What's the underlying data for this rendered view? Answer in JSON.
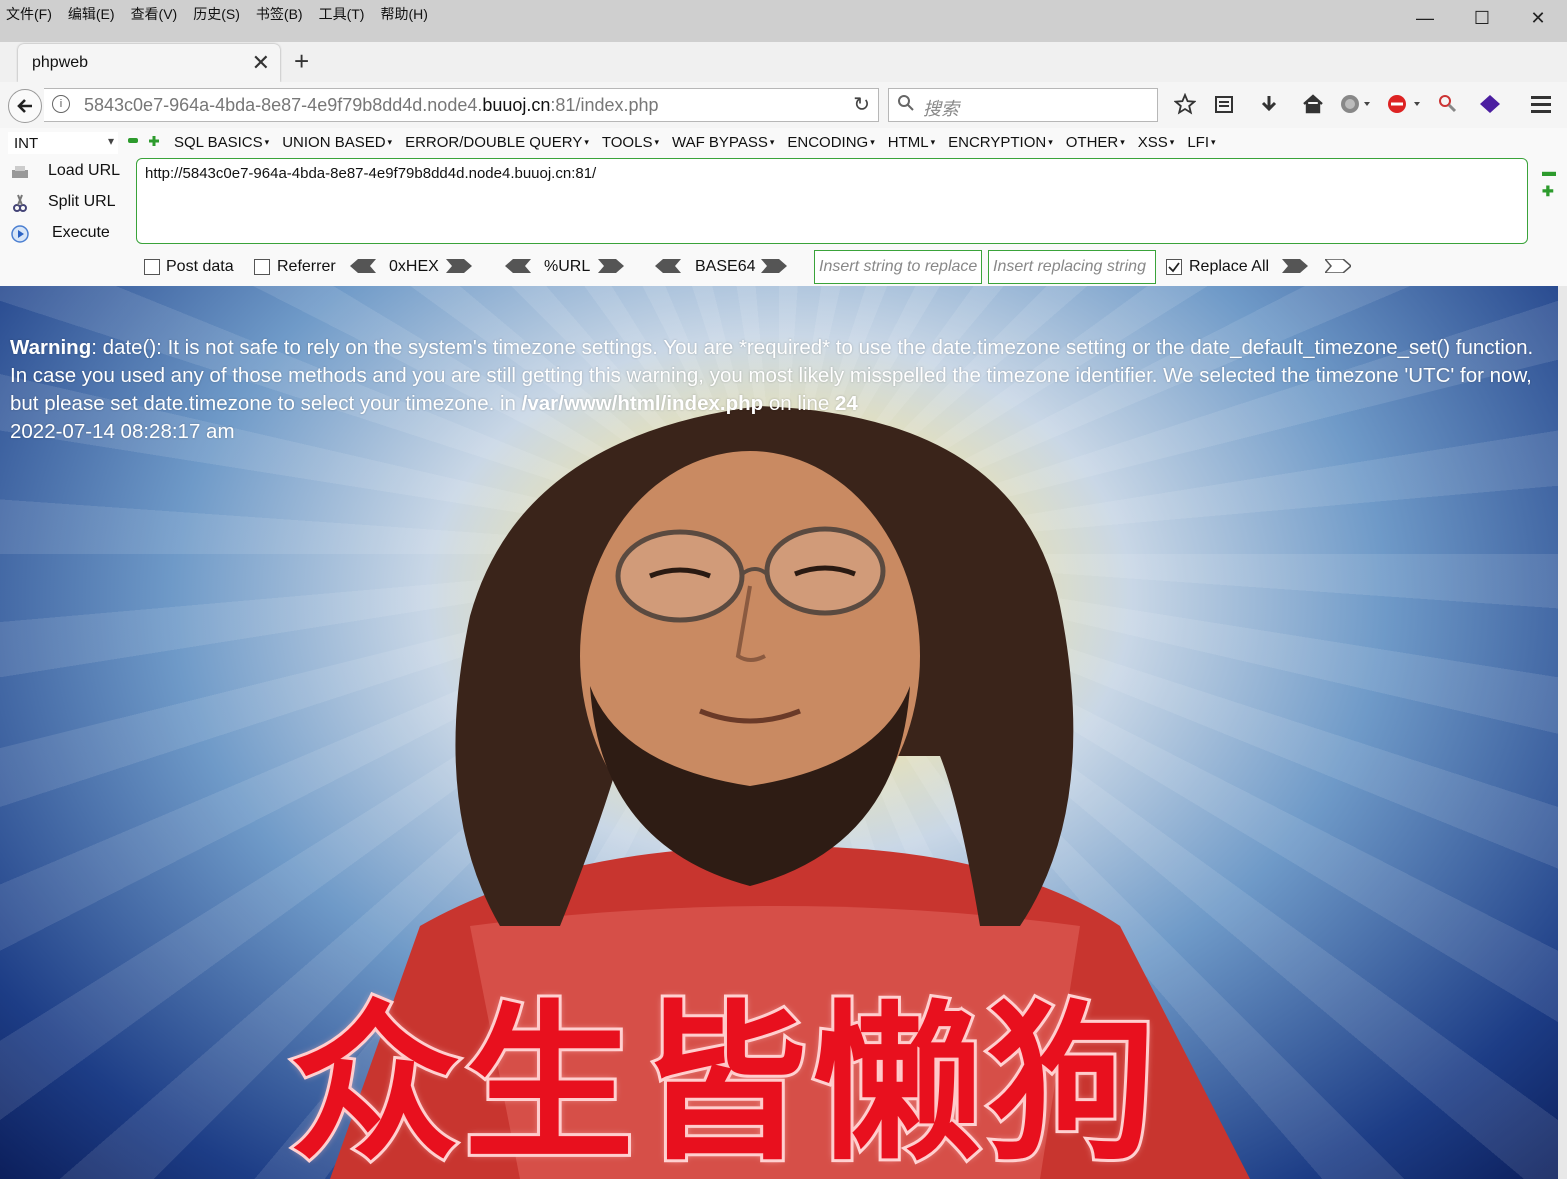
{
  "menubar": [
    "文件(F)",
    "编辑(E)",
    "查看(V)",
    "历史(S)",
    "书签(B)",
    "工具(T)",
    "帮助(H)"
  ],
  "window_controls": {
    "minimize": "—",
    "maximize": "☐",
    "close": "✕"
  },
  "tab": {
    "title": "phpweb",
    "close": "✕",
    "new_tab": "+"
  },
  "address": {
    "url_prefix": "5843c0e7-964a-4bda-8e87-4e9f79b8dd4d.node4.",
    "url_domain": "buuoj.cn",
    "url_suffix": ":81/index.php",
    "reload": "↻"
  },
  "search": {
    "placeholder": "搜索",
    "icon": "search-icon"
  },
  "hackbar": {
    "select_value": "INT",
    "menus": [
      "SQL BASICS",
      "UNION BASED",
      "ERROR/DOUBLE QUERY",
      "TOOLS",
      "WAF BYPASS",
      "ENCODING",
      "HTML",
      "ENCRYPTION",
      "OTHER",
      "XSS",
      "LFI"
    ],
    "load_url": "Load URL",
    "split_url": "Split URL",
    "execute": "Execute",
    "url_text": "http://5843c0e7-964a-4bda-8e87-4e9f79b8dd4d.node4.buuoj.cn:81/",
    "post_data": "Post data",
    "referrer": "Referrer",
    "hex": "0xHEX",
    "url_enc": "%URL",
    "base64": "BASE64",
    "insert_placeholder": "Insert string to replace",
    "replacing_placeholder": "Insert replacing string",
    "replace_all": "Replace All",
    "replace_all_checked": true
  },
  "page": {
    "warning_label": "Warning",
    "warning_text": ": date(): It is not safe to rely on the system's timezone settings. You are *required* to use the date.timezone setting or the date_default_timezone_set() function. In case you used any of those methods and you are still getting this warning, you most likely misspelled the timezone identifier. We selected the timezone 'UTC' for now, but please set date.timezone to select your timezone. in ",
    "warning_file": "/var/www/html/index.php",
    "warning_on_line": " on line ",
    "warning_line": "24",
    "datetime": "2022-07-14 08:28:17 am",
    "image_caption": "众生皆懒狗"
  }
}
